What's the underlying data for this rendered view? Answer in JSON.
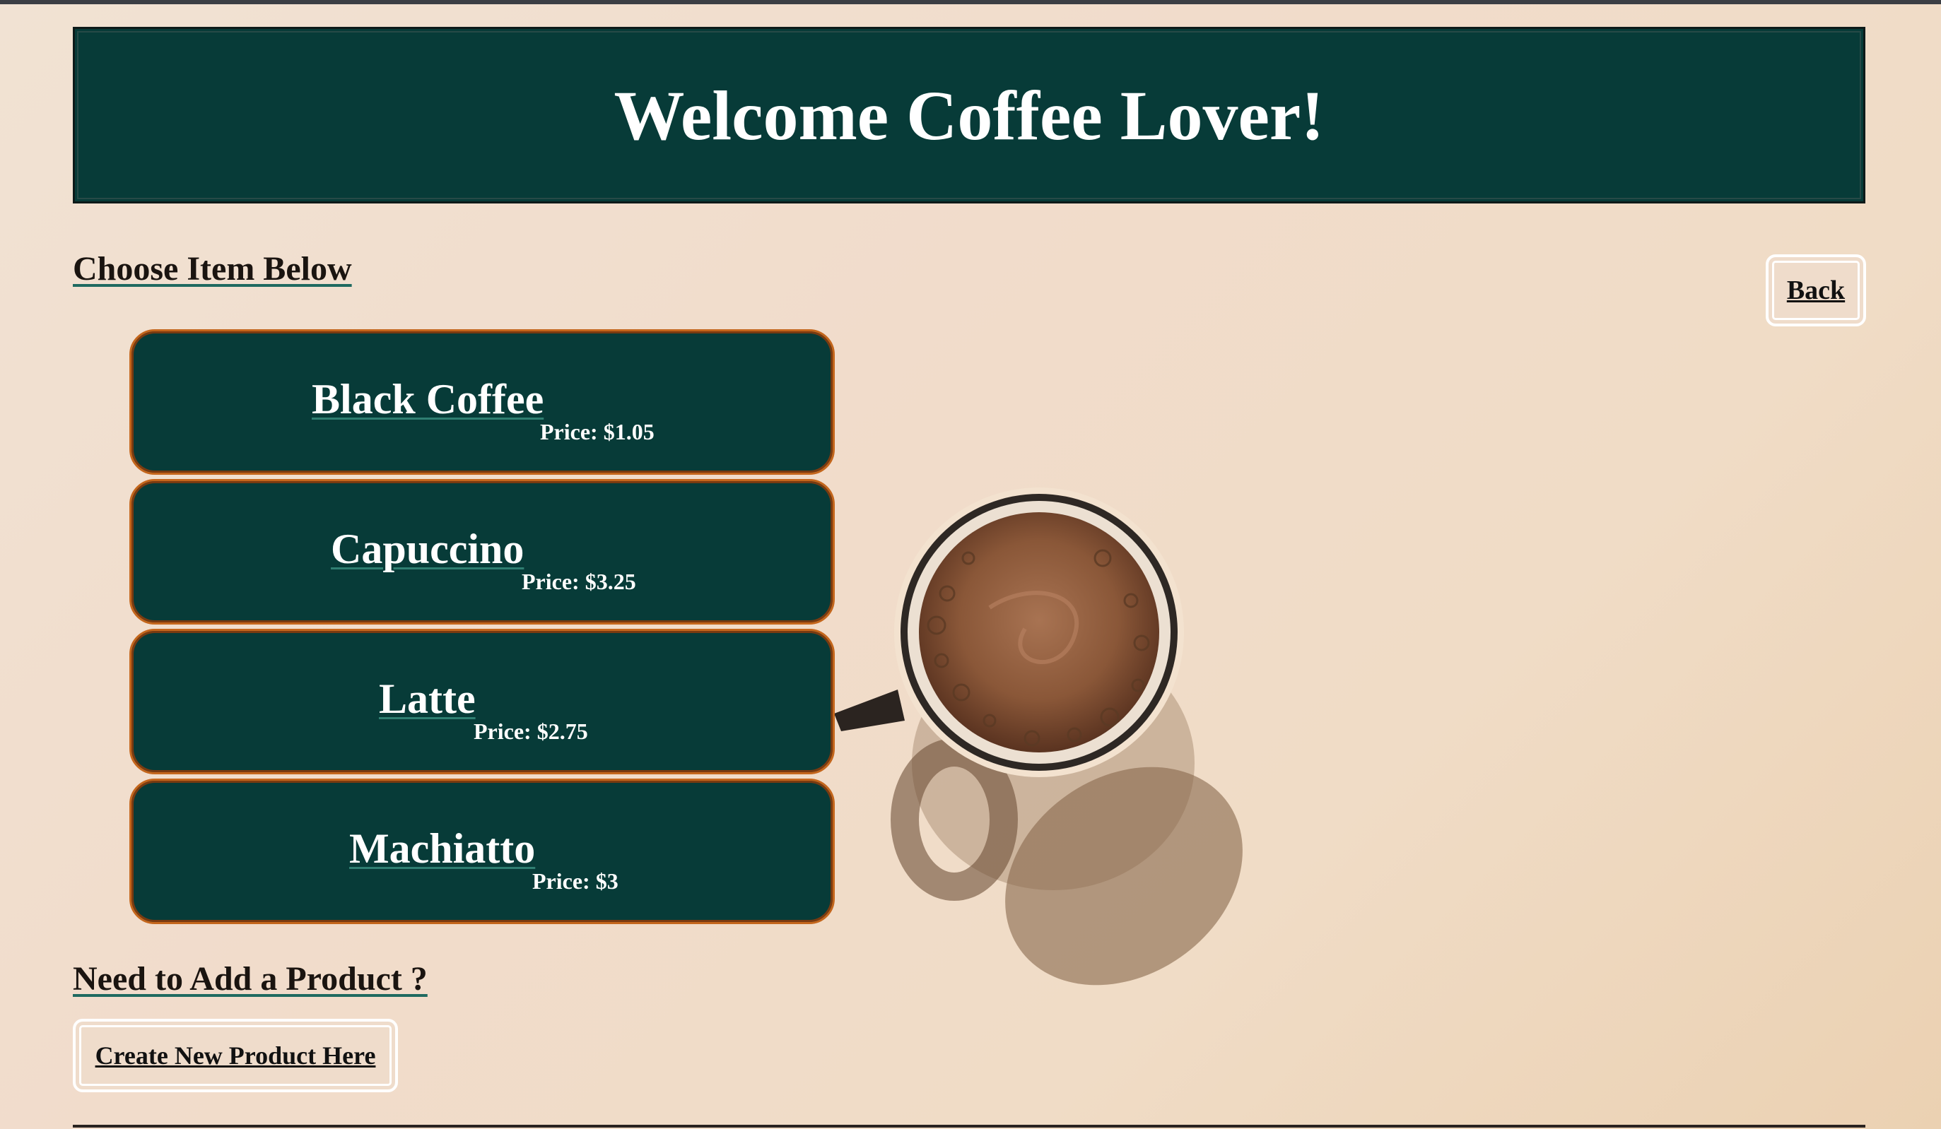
{
  "header": {
    "title": "Welcome Coffee Lover!"
  },
  "menu": {
    "section_title": "Choose Item Below",
    "back_label": "Back",
    "items": [
      {
        "name": "Black Coffee",
        "price": "Price: $1.05"
      },
      {
        "name": "Capuccino",
        "price": "Price: $3.25"
      },
      {
        "name": "Latte",
        "price": "Price: $2.75"
      },
      {
        "name": "Machiatto",
        "price": "Price: $3"
      }
    ]
  },
  "add_product": {
    "section_title": "Need to Add a Product ?",
    "create_label": "Create New Product Here"
  },
  "colors": {
    "header_bg": "#073b38",
    "card_bg": "#073b38",
    "card_border": "#c4661c",
    "page_bg": "#f1dfcd"
  }
}
